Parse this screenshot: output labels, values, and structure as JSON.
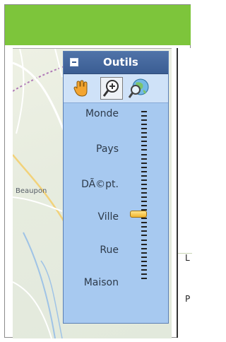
{
  "tools_panel": {
    "title": "Outils",
    "collapse_symbol": "−",
    "tools": [
      {
        "name": "pan-hand-icon",
        "label": ""
      },
      {
        "name": "zoom-icon",
        "label": ""
      },
      {
        "name": "locate-globe-icon",
        "label": ""
      }
    ],
    "zoom_levels": [
      "Monde",
      "Pays",
      "DÃ©pt.",
      "Ville",
      "Rue",
      "Maison"
    ],
    "zoom_level_fraction": 0.62
  },
  "map": {
    "place_label": "Beaupon"
  },
  "side_panel": {
    "chars": [
      "L",
      "P"
    ]
  },
  "colors": {
    "header_green": "#7dc53b",
    "panel_blue": "#a7c9f0",
    "panel_header": "#3b5d93"
  }
}
